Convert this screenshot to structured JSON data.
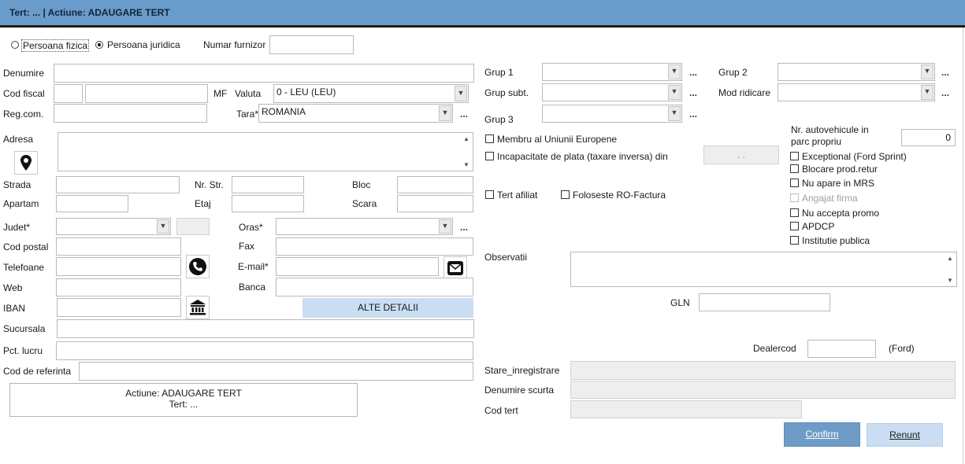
{
  "window": {
    "title": "Tert: ... | Actiune: ADAUGARE TERT"
  },
  "person_type": {
    "fizica_label": "Persoana fizica",
    "juridica_label": "Persoana juridica",
    "selected": "juridica"
  },
  "furnizor": {
    "label": "Numar furnizor",
    "value": ""
  },
  "left": {
    "denumire_label": "Denumire",
    "cod_fiscal_label": "Cod fiscal",
    "mf_label": "MF",
    "valuta_label": "Valuta",
    "valuta_value": "0 - LEU (LEU)",
    "regcom_label": "Reg.com.",
    "tara_label": "Tara*",
    "tara_value": "ROMANIA",
    "adresa_label": "Adresa",
    "strada_label": "Strada",
    "nrstr_label": "Nr. Str.",
    "bloc_label": "Bloc",
    "apartam_label": "Apartam",
    "etaj_label": "Etaj",
    "scara_label": "Scara",
    "judet_label": "Judet*",
    "oras_label": "Oras*",
    "codpostal_label": "Cod postal",
    "fax_label": "Fax",
    "telefoane_label": "Telefoane",
    "email_label": "E-mail*",
    "web_label": "Web",
    "banca_label": "Banca",
    "iban_label": "IBAN",
    "alte_detalii_label": "ALTE DETALII",
    "sucursala_label": "Sucursala",
    "pct_lucru_label": "Pct. lucru",
    "cod_referinta_label": "Cod de referinta",
    "status_line1": "Actiune: ADAUGARE TERT",
    "status_line2": "Tert: ..."
  },
  "right": {
    "grup1_label": "Grup 1",
    "grup2_label": "Grup 2",
    "grup_subt_label": "Grup subt.",
    "mod_ridicare_label": "Mod ridicare",
    "grup3_label": "Grup 3",
    "dots": "...",
    "membru_ue_label": "Membru al Uniunii Europene",
    "incapacitate_label": "Incapacitate de plata (taxare inversa) din",
    "incapacitate_date": ". .",
    "nr_auto_label_1": "Nr. autovehicule in",
    "nr_auto_label_2": "parc propriu",
    "nr_auto_value": "0",
    "exceptional_label": "Exceptional (Ford Sprint)",
    "blocare_label": "Blocare prod.retur",
    "nu_apare_mrs_label": "Nu apare in MRS",
    "angajat_firma_label": "Angajat firma",
    "nu_accepta_promo_label": "Nu accepta promo",
    "apdcp_label": "APDCP",
    "institutie_label": "Institutie publica",
    "tert_afiliat_label": "Tert afiliat",
    "ro_factura_label": "Foloseste RO-Factura",
    "observatii_label": "Observatii",
    "gln_label": "GLN",
    "dealercod_label": "Dealercod",
    "ford_label": "(Ford)",
    "stare_label": "Stare_inregistrare",
    "denumire_scurta_label": "Denumire scurta",
    "cod_tert_label": "Cod tert",
    "confirm_label": "Confirm",
    "renunt_label": "Renunt"
  },
  "colors": {
    "titlebar": "#6a9ccb",
    "confirm_bg": "#6f9cc6",
    "renunt_bg": "#c9def2",
    "alte_detalii_bg": "#c9def2"
  },
  "icons": [
    "location-pin-icon",
    "phone-icon",
    "email-icon",
    "bank-icon",
    "chevron-down-icon",
    "scroll-up-icon",
    "scroll-down-icon"
  ]
}
